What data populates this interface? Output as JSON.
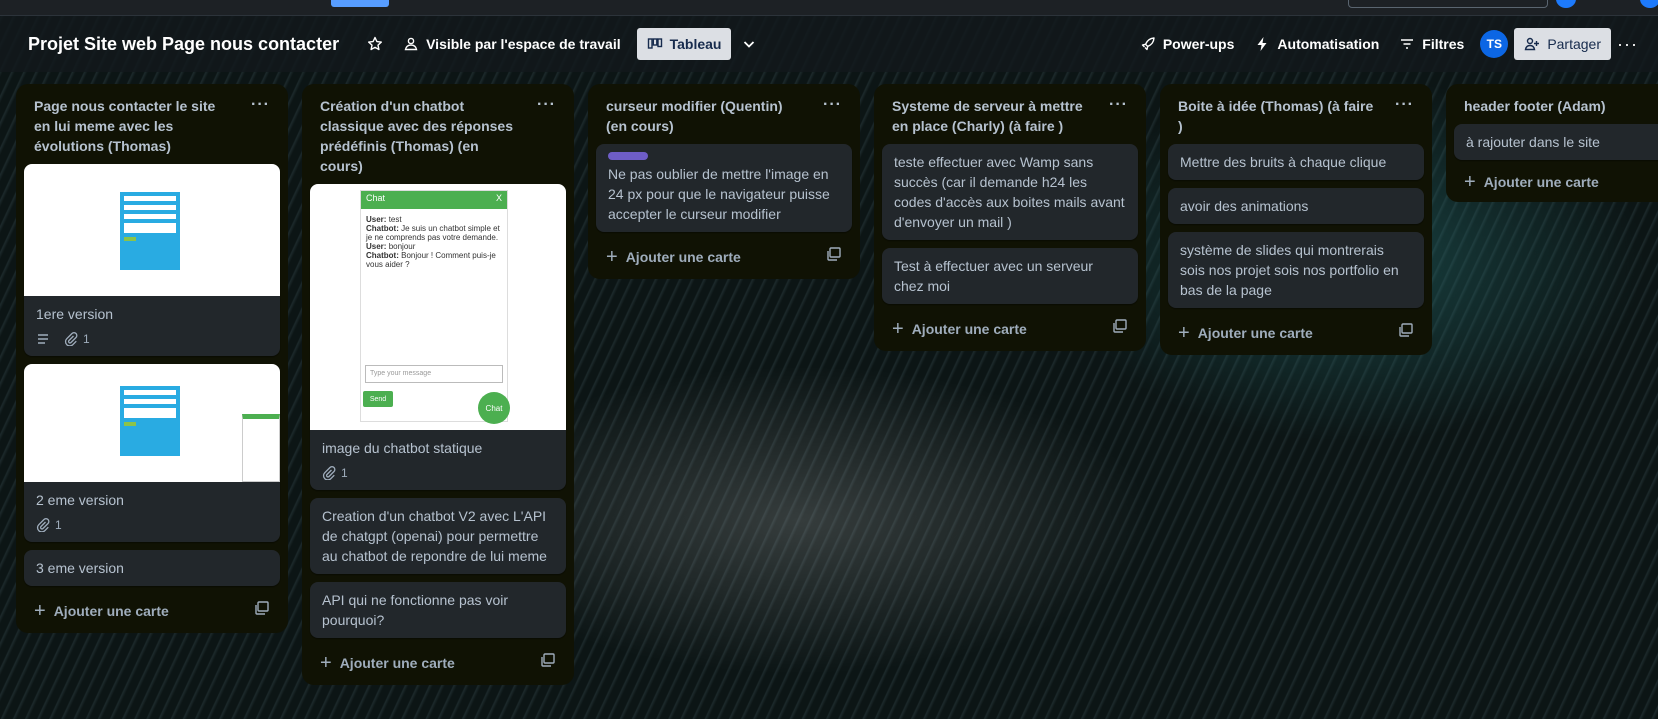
{
  "board": {
    "title": "Projet Site web Page nous contacter",
    "visibility": "Visible par l'espace de travail",
    "view": "Tableau",
    "powerups": "Power-ups",
    "automation": "Automatisation",
    "filters": "Filtres",
    "avatar_initials": "TS",
    "share": "Partager"
  },
  "add_card_label": "Ajouter une carte",
  "lists": [
    {
      "title": "Page nous contacter le site en lui meme avec les évolutions (Thomas)",
      "cards": [
        {
          "text": "1ere version",
          "attachments": "1"
        },
        {
          "text": "2 eme version",
          "attachments": "1"
        },
        {
          "text": "3 eme version"
        }
      ]
    },
    {
      "title": "Création d'un chatbot classique avec des réponses prédéfinis (Thomas) (en cours)",
      "cards": [
        {
          "text": "image du chatbot statique",
          "attachments": "1"
        },
        {
          "text": "Creation d'un chatbot V2 avec L'API de chatgpt (openai) pour permettre au chatbot de repondre de lui meme"
        },
        {
          "text": "API qui ne fonctionne pas voir pourquoi?"
        }
      ],
      "chat_preview": {
        "header": "Chat",
        "close": "X",
        "user_label": "User:",
        "bot_label": "Chatbot:",
        "msg1": "test",
        "reply1": "Je suis un chatbot simple et je ne comprends pas votre demande.",
        "msg2": "bonjour",
        "reply2": "Bonjour ! Comment puis-je vous aider ?",
        "placeholder": "Type your message",
        "send": "Send",
        "fab": "Chat"
      }
    },
    {
      "title": "curseur modifier (Quentin) (en cours)",
      "cards": [
        {
          "text": "Ne pas oublier de mettre l'image en 24 px pour que le navigateur puisse accepter le curseur modifier",
          "label_color": "#6e5dc6"
        }
      ]
    },
    {
      "title": "Systeme de serveur à mettre en place (Charly) (à faire )",
      "cards": [
        {
          "text": "teste effectuer avec Wamp sans succès (car il demande h24 les codes d'accès aux boites mails avant d'envoyer un mail )"
        },
        {
          "text": "Test à effectuer avec un serveur chez moi"
        }
      ]
    },
    {
      "title": "Boite à idée (Thomas) (à faire )",
      "cards": [
        {
          "text": "Mettre des bruits à chaque clique"
        },
        {
          "text": "avoir des animations"
        },
        {
          "text": "système de slides qui montrerais sois nos projet sois nos portfolio en bas de la page"
        }
      ]
    },
    {
      "title": "header footer (Adam)",
      "cards": [
        {
          "text": "à rajouter dans le site"
        }
      ]
    }
  ]
}
